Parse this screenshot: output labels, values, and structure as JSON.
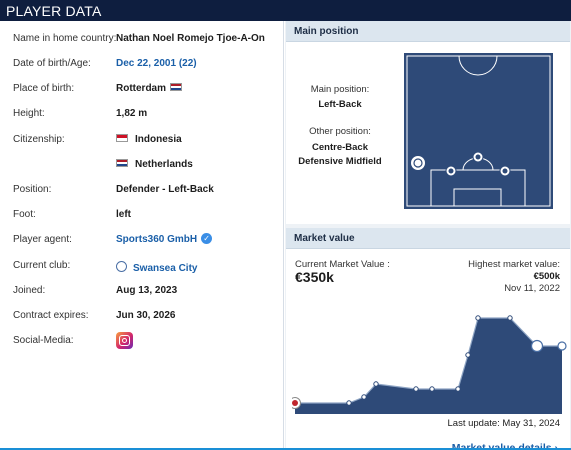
{
  "header": {
    "title": "PLAYER DATA"
  },
  "player_info": [
    {
      "label": "Name in home country:",
      "value": "Nathan Noel Romejo Tjoe-A-On"
    },
    {
      "label": "Date of birth/Age:",
      "value": "Dec 22, 2001 (22)"
    },
    {
      "label": "Place of birth:",
      "value": "Rotterdam",
      "flag": "netherlands-flag"
    },
    {
      "label": "Height:",
      "value": "1,82 m"
    },
    {
      "label": "Citizenship:",
      "value": "Indonesia",
      "flag": "indonesia-flag"
    },
    {
      "label": "",
      "value": "Netherlands",
      "flag": "netherlands-flag"
    },
    {
      "label": "Position:",
      "value": "Defender - Left-Back"
    },
    {
      "label": "Foot:",
      "value": "left"
    },
    {
      "label": "Player agent:",
      "value": "Sports360 GmbH",
      "icon": "verified-icon"
    },
    {
      "label": "Current club:",
      "value": "Swansea City",
      "icon": "club-crest-icon"
    },
    {
      "label": "Joined:",
      "value": "Aug 13, 2023"
    },
    {
      "label": "Contract expires:",
      "value": "Jun 30, 2026"
    },
    {
      "label": "Social-Media:",
      "icon": "instagram-icon"
    }
  ],
  "position_panel": {
    "title": "Main position",
    "main_label": "Main position:",
    "main_value": "Left-Back",
    "other_label": "Other position:",
    "other_values": [
      "Centre-Back",
      "Defensive Midfield"
    ],
    "pitch_color": "#2e4a78"
  },
  "market_value_panel": {
    "title": "Market value",
    "current_label": "Current Market Value :",
    "current_value": "€350k",
    "highest_label": "Highest market value:",
    "highest_value": "€500k",
    "highest_date": "Nov 11, 2022",
    "last_update": "Last update: May 31, 2024",
    "details_link": "Market value details",
    "area_color": "#2e4a78"
  },
  "colors": {
    "header_bg": "#0e1e3f",
    "link": "#1a5fa8",
    "panel_head": "#dce6ef"
  }
}
